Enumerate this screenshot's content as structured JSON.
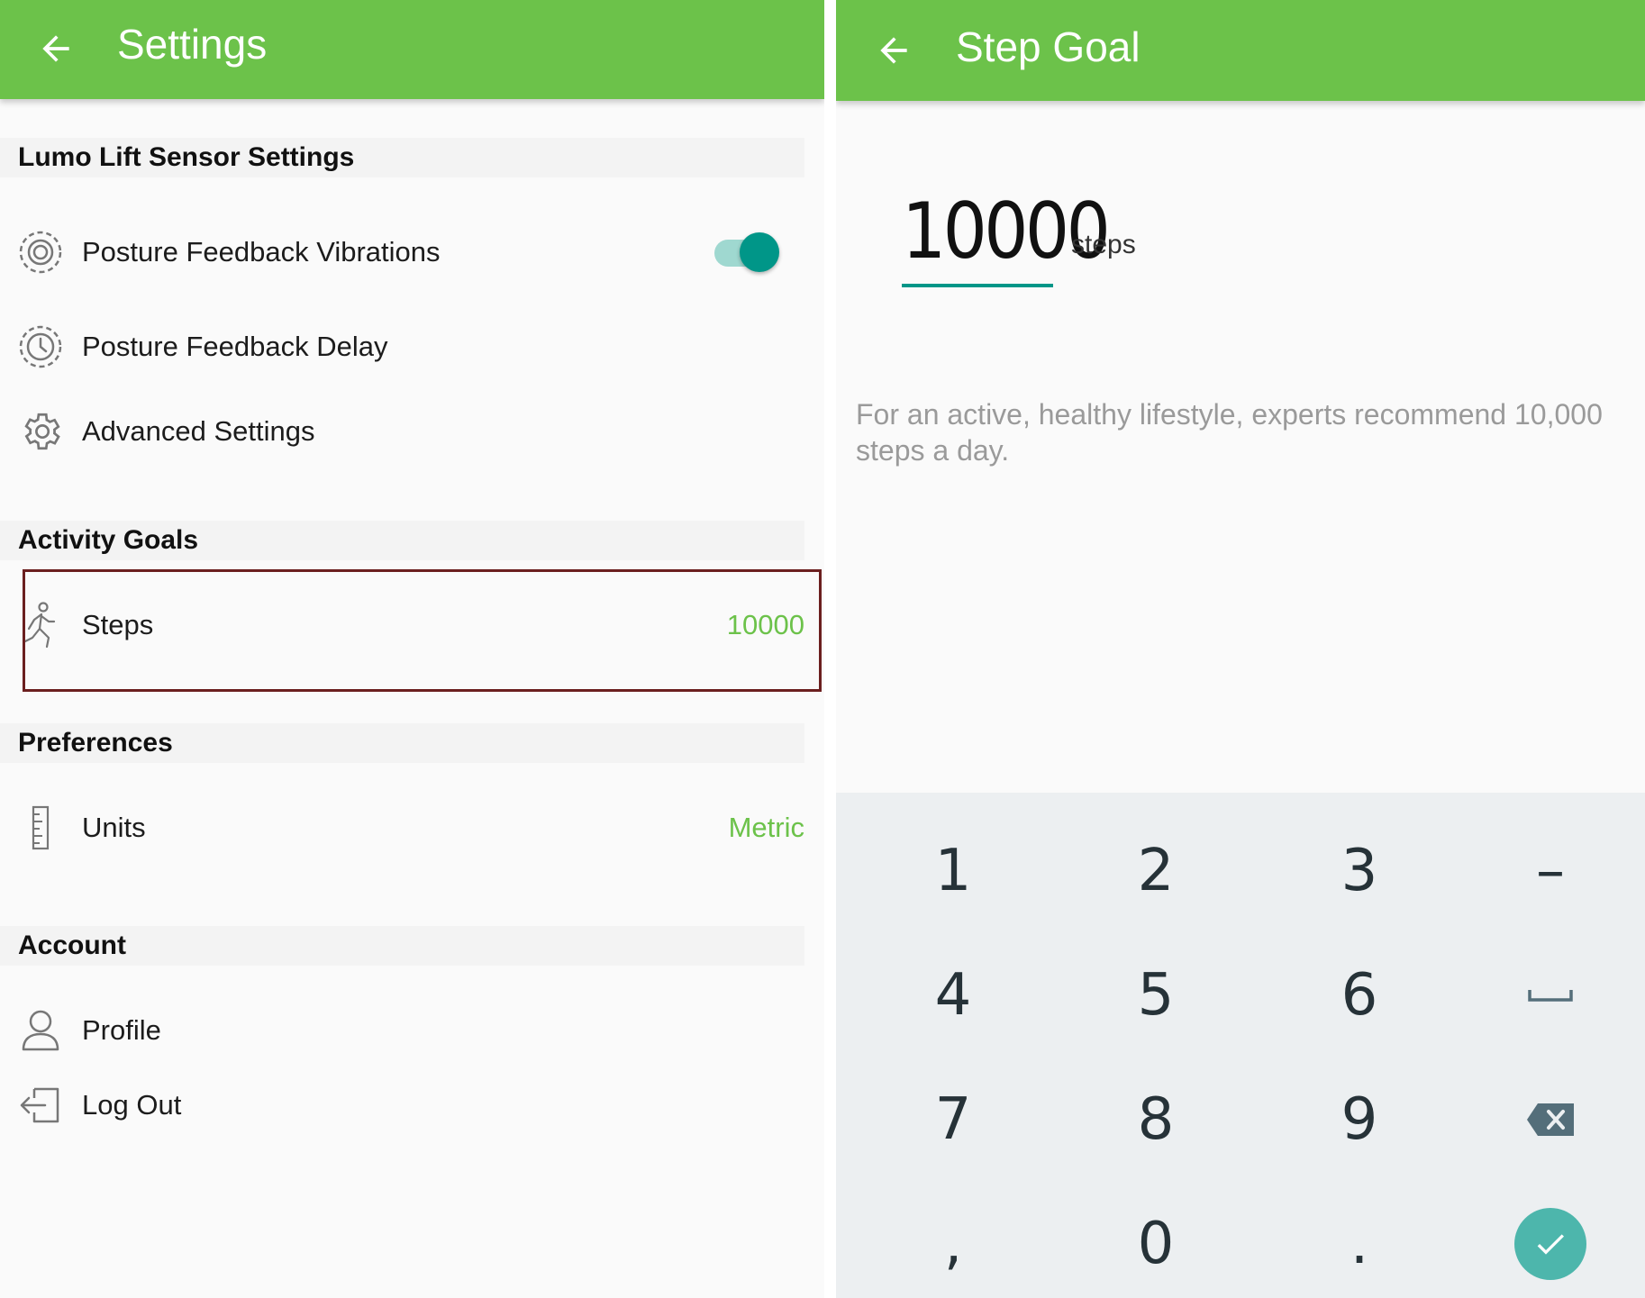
{
  "settings_screen": {
    "title": "Settings",
    "sections": {
      "lumo": {
        "header": "Lumo Lift Sensor Settings",
        "posture_vibrations": {
          "label": "Posture Feedback Vibrations",
          "icon": "vibration-target-icon",
          "toggle_on": true
        },
        "posture_delay": {
          "label": "Posture Feedback Delay",
          "icon": "timer-icon"
        },
        "advanced": {
          "label": "Advanced Settings",
          "icon": "gear-icon"
        }
      },
      "activity": {
        "header": "Activity Goals",
        "steps": {
          "label": "Steps",
          "value": "10000",
          "icon": "walking-person-icon"
        }
      },
      "preferences": {
        "header": "Preferences",
        "units": {
          "label": "Units",
          "value": "Metric",
          "icon": "ruler-icon"
        }
      },
      "account": {
        "header": "Account",
        "profile": {
          "label": "Profile",
          "icon": "person-icon"
        },
        "logout": {
          "label": "Log Out",
          "icon": "logout-icon"
        }
      }
    }
  },
  "step_goal_screen": {
    "title": "Step Goal",
    "goal_value": "10000",
    "goal_unit": "steps",
    "hint": "For an active, healthy lifestyle, experts recommend 10,000 steps a day.",
    "keypad": {
      "k1": "1",
      "k2": "2",
      "k3": "3",
      "k_minus": "–",
      "k4": "4",
      "k5": "5",
      "k6": "6",
      "k_space": "space-icon",
      "k7": "7",
      "k8": "8",
      "k9": "9",
      "k_backspace": "backspace-icon",
      "k_comma": ",",
      "k0": "0",
      "k_period": ".",
      "k_done": "check-icon"
    }
  },
  "colors": {
    "appbar": "#6cc24a",
    "accent_value": "#6cc24a",
    "teal": "#009688",
    "done_button": "#4db6ac",
    "highlight_border": "#6b1f1f"
  }
}
